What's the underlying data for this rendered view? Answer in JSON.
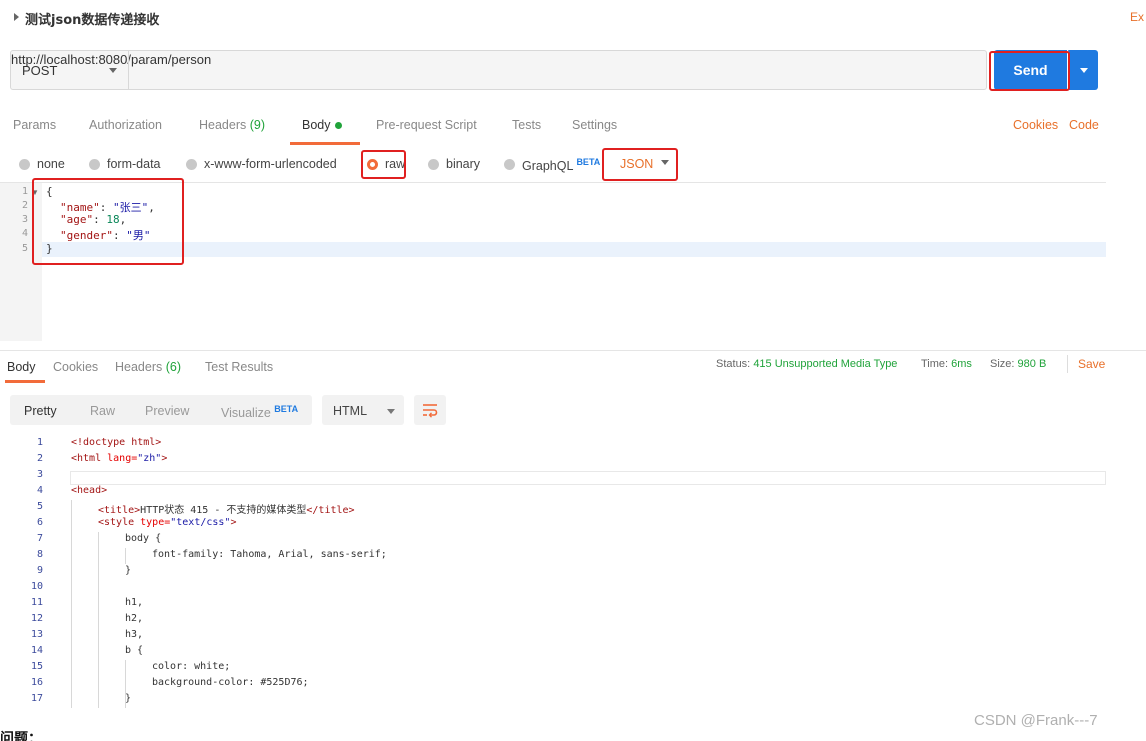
{
  "request": {
    "title": "测试json数据传递接收",
    "right_cut": "Ex",
    "method": "POST",
    "url": "http://localhost:8080/param/person",
    "send_label": "Send"
  },
  "request_tabs": {
    "params": "Params",
    "authorization": "Authorization",
    "headers": "Headers",
    "headers_count": "(9)",
    "body": "Body",
    "prerequest": "Pre-request Script",
    "tests": "Tests",
    "settings": "Settings",
    "cookies": "Cookies",
    "code": "Code"
  },
  "body_types": {
    "none": "none",
    "form_data": "form-data",
    "urlencoded": "x-www-form-urlencoded",
    "raw": "raw",
    "binary": "binary",
    "graphql": "GraphQL",
    "beta": "BETA",
    "format": "JSON",
    "selected": "raw"
  },
  "editor": {
    "line_numbers": [
      "1",
      "2",
      "3",
      "4",
      "5"
    ],
    "open_brace": "{",
    "close_brace": "}",
    "fields": [
      {
        "key": "\"name\"",
        "value": "\"张三\"",
        "sep": ": ",
        "end": ","
      },
      {
        "key": "\"age\"",
        "value": "18",
        "sep": ": ",
        "end": ","
      },
      {
        "key": "\"gender\"",
        "value": "\"男\"",
        "sep": ": ",
        "end": ""
      }
    ]
  },
  "response_tabs": {
    "body": "Body",
    "cookies": "Cookies",
    "headers": "Headers",
    "headers_count": "(6)",
    "test_results": "Test Results",
    "status_label": "Status:",
    "status_value": "415 Unsupported Media Type",
    "time_label": "Time:",
    "time_value": "6ms",
    "size_label": "Size:",
    "size_value": "980 B",
    "save": "Save"
  },
  "response_view": {
    "pretty": "Pretty",
    "raw": "Raw",
    "preview": "Preview",
    "visualize": "Visualize",
    "beta": "BETA",
    "format": "HTML"
  },
  "response_code": {
    "line_numbers": [
      "1",
      "2",
      "3",
      "4",
      "5",
      "6",
      "7",
      "8",
      "9",
      "10",
      "11",
      "12",
      "13",
      "14",
      "15",
      "16",
      "17"
    ],
    "l1": "<!doctype html>",
    "l2_a": "<html",
    "l2_attr": " lang=",
    "l2_val": "\"zh\"",
    "l2_b": ">",
    "l4": "<head>",
    "l5_a": "<title>",
    "l5_text": "HTTP状态 415 - 不支持的媒体类型",
    "l5_b": "</title>",
    "l6_a": "<style",
    "l6_attr": " type=",
    "l6_val": "\"text/css\"",
    "l6_b": ">",
    "l7": "body {",
    "l8": "font-family: Tahoma, Arial, sans-serif;",
    "l9": "}",
    "l11": "h1,",
    "l12": "h2,",
    "l13": "h3,",
    "l14": "b {",
    "l15": "color: white;",
    "l16": "background-color: #525D76;",
    "l17": "}"
  },
  "footer": {
    "watermark": "CSDN @Frank---7",
    "question": "问题："
  }
}
